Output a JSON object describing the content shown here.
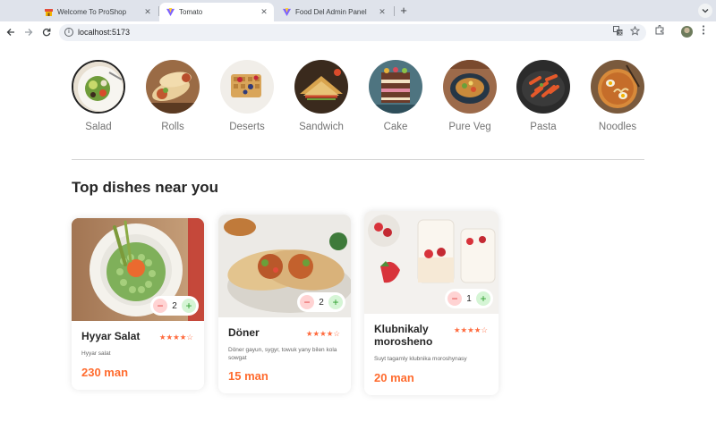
{
  "browser": {
    "tabs": [
      {
        "title": "Welcome To ProShop",
        "active": false,
        "icon": "shop-favicon"
      },
      {
        "title": "Tomato",
        "active": true,
        "icon": "vite-favicon"
      },
      {
        "title": "Food Del Admin Panel",
        "active": false,
        "icon": "vite-favicon"
      }
    ],
    "close_glyph": "✕",
    "new_tab_glyph": "+",
    "url": "localhost:5173"
  },
  "categories": [
    {
      "label": "Salad"
    },
    {
      "label": "Rolls"
    },
    {
      "label": "Deserts"
    },
    {
      "label": "Sandwich"
    },
    {
      "label": "Cake"
    },
    {
      "label": "Pure Veg"
    },
    {
      "label": "Pasta"
    },
    {
      "label": "Noodles"
    }
  ],
  "section_title": "Top dishes near you",
  "dishes": [
    {
      "name": "Hyyar Salat",
      "rating": 4,
      "description": "Hyyar salat",
      "price": "230 man",
      "quantity": "2"
    },
    {
      "name": "Döner",
      "rating": 4,
      "description": "Döner gayun, sygyr, towuk yany bilen kola sowgat",
      "price": "15 man",
      "quantity": "2"
    },
    {
      "name": "Klubnikaly morosheno",
      "rating": 4,
      "description": "Suyt tagamly klubnika moroshynasy",
      "price": "20 man",
      "quantity": "1"
    }
  ],
  "counter": {
    "minus": "−",
    "plus": "+"
  },
  "colors": {
    "accent": "#ff6b2e",
    "star": "#ff6a3d",
    "minus_bg": "#ffd3d3",
    "plus_bg": "#d5f5d5"
  }
}
